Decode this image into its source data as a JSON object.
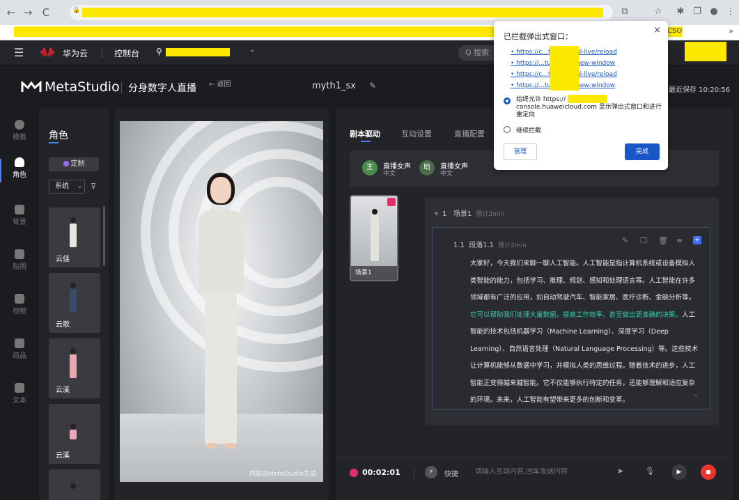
{
  "browser": {
    "back": "←",
    "forward": "→",
    "reload": "C",
    "lock": "🔒",
    "ext_icons": [
      "⧉",
      "☆",
      "✱",
      "❐",
      "●",
      "⋮"
    ],
    "bookmark_cso": "CSO",
    "bookmark_more": "»"
  },
  "cloud_nav": {
    "menu": "☰",
    "brand": "华为云",
    "console": "控制台",
    "region_caret": "⌄",
    "search_placeholder": "Q 搜索"
  },
  "header": {
    "logo_name": "MetaStudio",
    "title": "分身数字人直播",
    "back": "← 返回",
    "project_name": "myth1_sx",
    "last_saved": "最近保存 10:20:56"
  },
  "rail": [
    {
      "label": "模板",
      "active": false
    },
    {
      "label": "角色",
      "active": true
    },
    {
      "label": "背景",
      "active": false
    },
    {
      "label": "贴图",
      "active": false
    },
    {
      "label": "视频",
      "active": false
    },
    {
      "label": "商品",
      "active": false
    },
    {
      "label": "文本",
      "active": false
    }
  ],
  "roles": {
    "title": "角色",
    "custom_btn": "定制",
    "filter_select": "系统",
    "filter_caret": "⌄",
    "items": [
      {
        "name": "云佳",
        "color": "#e8e6e0"
      },
      {
        "name": "云歌",
        "color": "#3a4a6a"
      },
      {
        "name": "云溪",
        "color": "#e8a8b0"
      },
      {
        "name": "云溪",
        "color": "#e8a8b8"
      }
    ]
  },
  "preview": {
    "watermark": "内容由MetaStudio生成"
  },
  "script": {
    "tabs": [
      "剧本驱动",
      "互动设置",
      "直播配置"
    ],
    "voices": [
      {
        "avatar": "主",
        "name": "直播女声",
        "lang": "中文"
      },
      {
        "avatar": "助",
        "name": "直播女声",
        "lang": "中文"
      }
    ],
    "scene_thumb_label": "场景1",
    "scene": {
      "index": "1",
      "name": "场景1",
      "estimate": "预计2min"
    },
    "paragraph": {
      "index": "1.1",
      "name": "段落1.1",
      "estimate": "预计2min",
      "text_a": "大家好，今天我们来聊一聊人工智能。人工智能是指计算机系统或设备模拟人类智能的能力，包括学习、推理、规划、感知和处理语言等。人工智能在许多领域都有广泛的应用，如自动驾驶汽车、智能家居、医疗诊断、金融分析等。",
      "text_highlight": "它可以帮助我们处理大量数据，提高工作效率，甚至做出更准确的决策。",
      "text_b": "人工智能的技术包括机器学习（Machine Learning）、深度学习（Deep Learning）、自然语言处理（Natural Language Processing）等。这些技术让计算机能够从数据中学习，并模拟人类的思维过程。随着技术的进步，人工智能正变得越来越智能。它不仅能够执行特定的任务，还能够理解和适应复杂的环境。未来，人工智能有望带来更多的创新和变革。"
    },
    "bottom": {
      "timer": "00:02:01",
      "quick_label": "快捷",
      "input_placeholder": "请输入互动内容,回车发送内容"
    }
  },
  "popup": {
    "title": "已拦截弹出式窗口：",
    "close": "×",
    "links": [
      "• https://c...two-virtual-live/reload",
      "• https://...tudio/live-new-window",
      "• https://c...two-virtual-live/reload",
      "• https://...tudio/live-new-window"
    ],
    "opt_allow_a": "始终允许 https://",
    "opt_allow_b": "console.huaweicloud.com 显示弹出式窗口和进行重定向",
    "opt_block": "继续拦截",
    "manage": "管理",
    "done": "完成"
  }
}
